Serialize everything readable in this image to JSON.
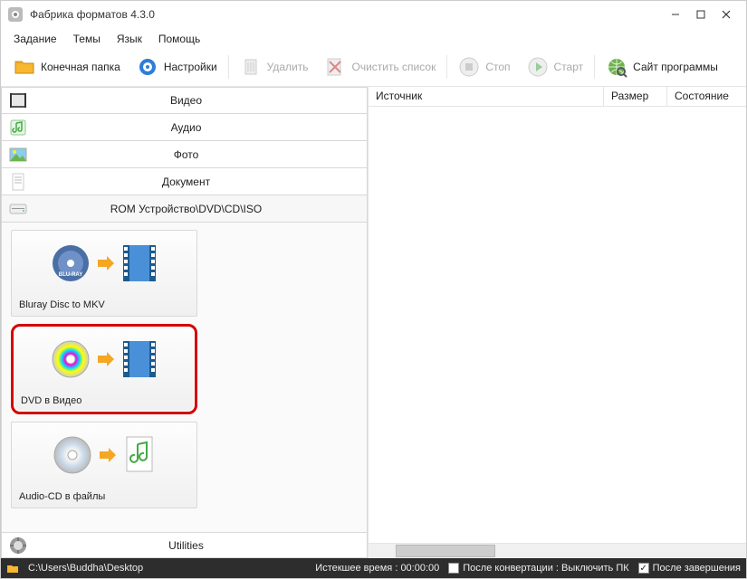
{
  "window": {
    "title": "Фабрика форматов 4.3.0"
  },
  "menu": {
    "items": [
      "Задание",
      "Темы",
      "Язык",
      "Помощь"
    ]
  },
  "toolbar": {
    "output_folder": "Конечная папка",
    "settings": "Настройки",
    "delete": "Удалить",
    "clear_list": "Очистить список",
    "stop": "Стоп",
    "start": "Старт",
    "site": "Сайт программы"
  },
  "categories": {
    "video": "Видео",
    "audio": "Аудио",
    "photo": "Фото",
    "document": "Документ",
    "rom": "ROM Устройство\\DVD\\CD\\ISO"
  },
  "tiles": {
    "bluray": "Bluray Disc to MKV",
    "dvd": "DVD в Видео",
    "audiocd": "Audio-CD в файлы"
  },
  "utilities": "Utilities",
  "grid": {
    "cols": {
      "source": "Источник",
      "size": "Размер",
      "state": "Состояние"
    }
  },
  "status": {
    "path": "C:\\Users\\Buddha\\Desktop",
    "elapsed_label": "Истекшее время :",
    "elapsed_value": "00:00:00",
    "after_conv": "После конвертации : Выключить ПК",
    "after_done": "После завершения"
  }
}
